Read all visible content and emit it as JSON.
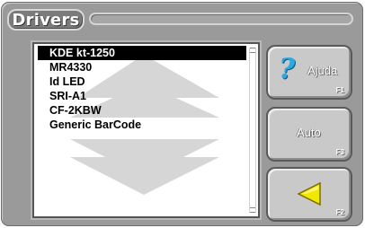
{
  "window": {
    "title": "Drivers"
  },
  "list": {
    "items": [
      {
        "label": "KDE kt-1250",
        "selected": true
      },
      {
        "label": "MR4330",
        "selected": false
      },
      {
        "label": "Id LED",
        "selected": false
      },
      {
        "label": "SRI-A1",
        "selected": false
      },
      {
        "label": "CF-2KBW",
        "selected": false
      },
      {
        "label": "Generic BarCode",
        "selected": false
      }
    ]
  },
  "buttons": {
    "help": {
      "label": "Ajuda",
      "key": "F1",
      "icon": "help-question-icon"
    },
    "auto": {
      "label": "Auto",
      "key": "F3"
    },
    "back": {
      "label": "",
      "key": "F2",
      "icon": "back-arrow-icon"
    }
  },
  "colors": {
    "panel": "#9a9a9a",
    "button": "#c9c9c9",
    "help_icon": "#2fa8e0",
    "back_arrow": "#f0e800",
    "selection": "#000000"
  }
}
